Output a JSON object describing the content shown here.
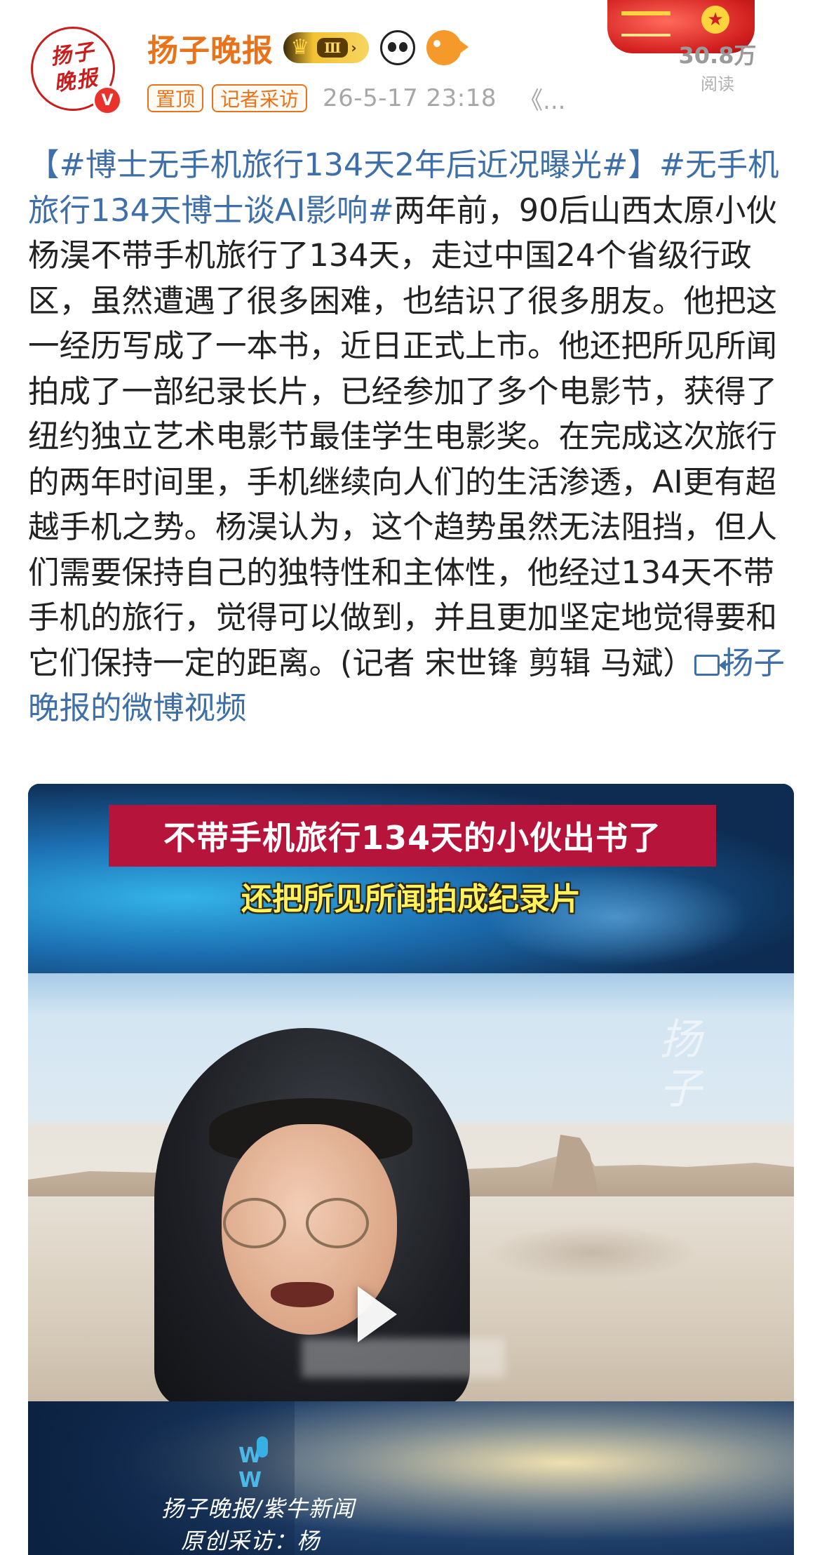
{
  "header": {
    "avatar_logo_text": "扬子晚报",
    "verified_mark": "V",
    "username": "扬子晚报",
    "vip_level": "Ⅲ",
    "tags": [
      "置顶",
      "记者采访"
    ],
    "timestamp": "26-5-17 23:18",
    "more": "《...",
    "read_count": "30.8万",
    "read_label": "阅读"
  },
  "post": {
    "topic1": "【#博士无手机旅行134天2年后近况曝光#】",
    "topic2": "#无手机旅行134天博士谈AI影响#",
    "body": "两年前，90后山西太原小伙杨淏不带手机旅行了134天，走过中国24个省级行政区，虽然遭遇了很多困难，也结识了很多朋友。他把这一经历写成了一本书，近日正式上市。他还把所见所闻拍成了一部纪录长片，已经参加了多个电影节，获得了纽约独立艺术电影节最佳学生电影奖。在完成这次旅行的两年时间里，手机继续向人们的生活渗透，AI更有超越手机之势。杨淏认为，这个趋势虽然无法阻挡，但人们需要保持自己的独特性和主体性，他经过134天不带手机的旅行，觉得可以做到，并且更加坚定地觉得要和它们保持一定的距离。(记者 宋世锋 剪辑 马斌）",
    "video_link_text": "扬子晚报的微博视频"
  },
  "video": {
    "title_banner": "不带手机旅行134天的小伙出书了",
    "subtitle": "还把所见所闻拍成纪录片",
    "watermark": "扬子",
    "source_credit": "扬子晚报/紫牛新闻",
    "credit_line": "原创采访：杨淏"
  },
  "colors": {
    "username": "#e8731a",
    "topic_link": "#3e6fa8",
    "banner_red": "#b6143a",
    "subtitle_yellow": "#fff25a"
  },
  "icons": [
    "verified-icon",
    "crown-icon",
    "panda-emoji-icon",
    "fish-emoji-icon",
    "video-link-icon",
    "play-icon"
  ]
}
